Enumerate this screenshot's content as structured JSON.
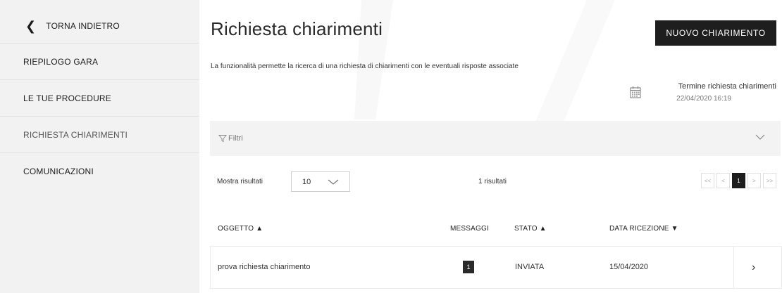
{
  "sidebar": {
    "back_label": "TORNA INDIETRO",
    "items": [
      {
        "label": "RIEPILOGO GARA"
      },
      {
        "label": "LE TUE PROCEDURE"
      },
      {
        "label": "RICHIESTA CHIARIMENTI"
      },
      {
        "label": "COMUNICAZIONI"
      }
    ]
  },
  "header": {
    "title": "Richiesta chiarimenti",
    "new_button": "NUOVO CHIARIMENTO",
    "description": "La funzionalità permette la ricerca di una richiesta di chiarimenti con le eventuali risposte associate",
    "deadline_label": "Termine richiesta chiarimenti",
    "deadline_date": "22/04/2020 16:19"
  },
  "filters": {
    "label": "Filtri"
  },
  "results": {
    "show_label": "Mostra risultati",
    "page_size": "10",
    "count_text": "1 risultati"
  },
  "pagination": {
    "first": "<<",
    "prev": "<",
    "current": "1",
    "next": ">",
    "last": ">>"
  },
  "table": {
    "columns": {
      "oggetto": "OGGETTO ▲",
      "messaggi": "MESSAGGI",
      "stato": "STATO ▲",
      "data": "DATA RICEZIONE ▼"
    },
    "rows": [
      {
        "oggetto": "prova richiesta chiarimento",
        "messaggi": "1",
        "stato": "INVIATA",
        "data": "15/04/2020"
      }
    ]
  },
  "icons": {
    "back": "chevron-left-icon",
    "calendar": "calendar-icon",
    "filter": "funnel-icon",
    "expand": "chevron-down-icon",
    "row_open": "chevron-right-icon"
  }
}
